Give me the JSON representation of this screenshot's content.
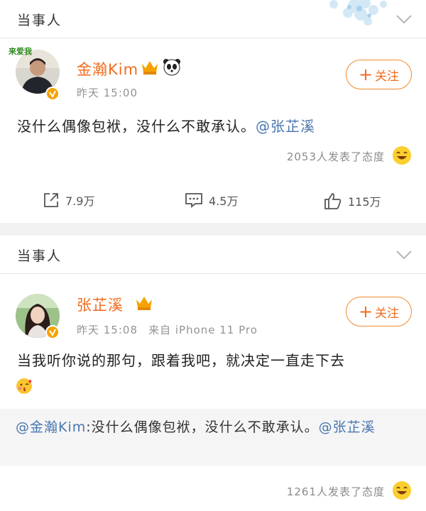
{
  "posts": [
    {
      "section_title": "当事人",
      "user": {
        "name": "金瀚Kim",
        "avatar_caption": "来爱我"
      },
      "timestamp": "昨天 15:00",
      "source": "",
      "follow_label": "关注",
      "body": "没什么偶像包袱，没什么不敢承认。",
      "mention": "@张芷溪",
      "attitude": "2053人发表了态度",
      "stats": {
        "repost": "7.9万",
        "comment": "4.5万",
        "like": "115万"
      }
    },
    {
      "section_title": "当事人",
      "user": {
        "name": "张芷溪"
      },
      "timestamp": "昨天 15:08",
      "source": "来自 iPhone 11 Pro",
      "follow_label": "关注",
      "body": "当我听你说的那句，跟着我吧，就决定一直走下去",
      "repost": {
        "mention": "@金瀚Kim",
        "text": ":没什么偶像包袱，没什么不敢承认。",
        "mention2": "@张芷溪"
      },
      "attitude": "1261人发表了态度"
    }
  ],
  "colors": {
    "username": "#f26b1d",
    "mention": "#4a77b0",
    "badge": "#f6a200"
  }
}
